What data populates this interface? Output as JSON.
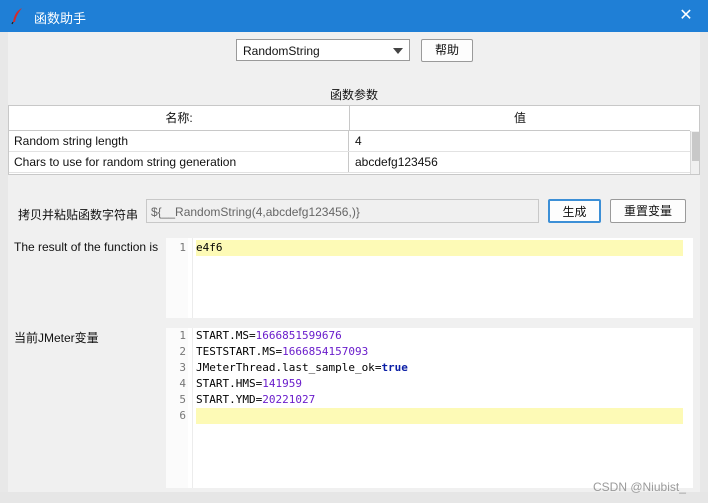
{
  "window": {
    "title": "函数助手",
    "close_glyph": "✕"
  },
  "function_select": {
    "value": "RandomString"
  },
  "help_button": "帮助",
  "params": {
    "section_title": "函数参数",
    "headers": {
      "name": "名称:",
      "value": "值"
    },
    "rows": [
      {
        "name": "Random string length",
        "value": "4"
      },
      {
        "name": "Chars to use for random string generation",
        "value": "abcdefg123456"
      }
    ]
  },
  "copy": {
    "label": "拷贝并粘贴函数字符串",
    "value": "${__RandomString(4,abcdefg123456,)}"
  },
  "generate_button": "生成",
  "reset_button": "重置变量",
  "result": {
    "label": "The result of the function is",
    "lines": [
      "e4f6"
    ],
    "line_numbers": [
      "1"
    ]
  },
  "vars": {
    "label": "当前JMeter变量",
    "line_numbers": [
      "1",
      "2",
      "3",
      "4",
      "5",
      "6"
    ],
    "lines": [
      {
        "key": "START.MS",
        "eq": "=",
        "val": "1666851599676"
      },
      {
        "key": "TESTSTART.MS",
        "eq": "=",
        "val": "1666854157093"
      },
      {
        "key": "JMeterThread.last_sample_ok",
        "eq": "=",
        "val": "true"
      },
      {
        "key": "START.HMS",
        "eq": "=",
        "val": "141959"
      },
      {
        "key": "START.YMD",
        "eq": "=",
        "val": "20221027"
      }
    ]
  },
  "watermark": "CSDN @Niubist_",
  "colors": {
    "titlebar": "#1f7fd6",
    "highlight": "#fdfab6",
    "number": "#6a1dcb",
    "keyword": "#0b1fa6"
  }
}
